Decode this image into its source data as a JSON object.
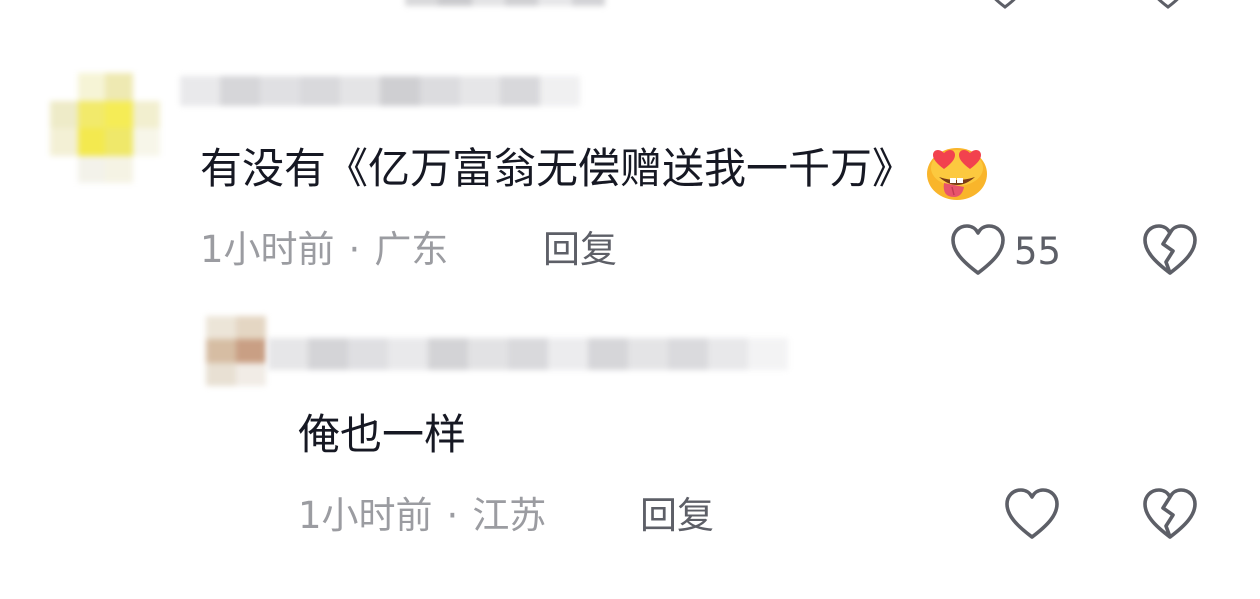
{
  "comments": [
    {
      "text": "有没有《亿万富翁无偿赠送我一千万》",
      "emoji": "heart-eyes-tongue-emoji",
      "time": "1小时前",
      "separator": "·",
      "location": "广东",
      "reply_label": "回复",
      "like_count": "55",
      "like_icon": "heart-outline-icon",
      "dislike_icon": "broken-heart-icon"
    },
    {
      "text": "俺也一样",
      "time": "1小时前",
      "separator": "·",
      "location": "江苏",
      "reply_label": "回复",
      "like_icon": "heart-outline-icon",
      "dislike_icon": "broken-heart-icon"
    }
  ],
  "colors": {
    "text": "#161823",
    "meta": "#9b9ca1",
    "reply": "#5d5f67",
    "icon": "#5d5f67",
    "emoji_face": "#f9b52b",
    "emoji_heart": "#f2424e",
    "emoji_tongue": "#e8546b"
  }
}
